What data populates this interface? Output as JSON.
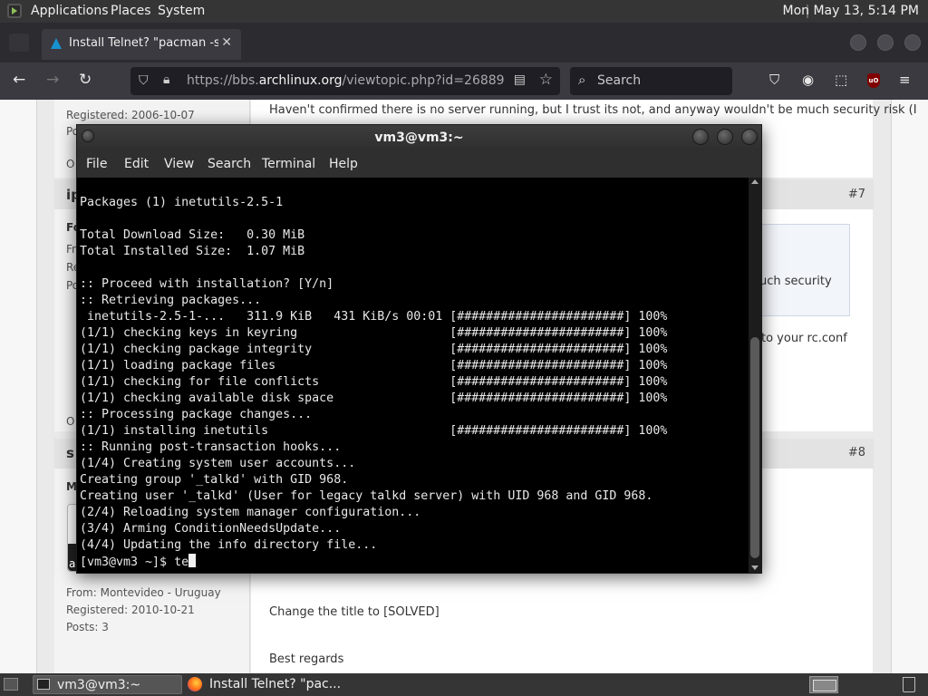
{
  "top_panel": {
    "menus": [
      "Applications",
      "Places",
      "System"
    ],
    "clock": "Mon May 13,  5:14 PM"
  },
  "browser": {
    "tab_title": "Install Telnet? \"pacman -s te",
    "tab_close": "✕",
    "url_prefix": "https://bbs.",
    "url_domain": "archlinux.org",
    "url_suffix": "/viewtopic.php?id=26889",
    "search_placeholder": "Search"
  },
  "page": {
    "post_top_text": "Haven't confirmed there is no server running, but I trust its not, and anyway wouldn't be much security risk (I",
    "registered_1": "Registered: 2006-10-07",
    "post_label_po": "Po",
    "post_label_o": "O",
    "author_2_fragment": "ip",
    "post_num_7": "#7",
    "frag_fo": "Fo",
    "frag_fr": "Fr",
    "frag_re": "Re",
    "frag_po": "Po",
    "quote_tail": "uch security",
    "rc_conf_tail": "to your rc.conf",
    "frag_o2": "O",
    "author_3_fragment": "s",
    "post_num_8": "#8",
    "frag_m": "M",
    "frag_a": "a",
    "from": "From: Montevideo - Uruguay",
    "registered_2": "Registered: 2010-10-21",
    "posts": "Posts: 3",
    "change_title": "Change the title to [SOLVED]",
    "best_regards": "Best regards"
  },
  "terminal": {
    "title": "vm3@vm3:~",
    "menus": [
      "File",
      "Edit",
      "View",
      "Search",
      "Terminal",
      "Help"
    ],
    "lines": [
      "Packages (1) inetutils-2.5-1",
      "",
      "Total Download Size:   0.30 MiB",
      "Total Installed Size:  1.07 MiB",
      "",
      ":: Proceed with installation? [Y/n]",
      ":: Retrieving packages...",
      " inetutils-2.5-1-...   311.9 KiB   431 KiB/s 00:01 [#######################] 100%",
      "(1/1) checking keys in keyring                     [#######################] 100%",
      "(1/1) checking package integrity                   [#######################] 100%",
      "(1/1) loading package files                        [#######################] 100%",
      "(1/1) checking for file conflicts                  [#######################] 100%",
      "(1/1) checking available disk space                [#######################] 100%",
      ":: Processing package changes...",
      "(1/1) installing inetutils                         [#######################] 100%",
      ":: Running post-transaction hooks...",
      "(1/4) Creating system user accounts...",
      "Creating group '_talkd' with GID 968.",
      "Creating user '_talkd' (User for legacy talkd server) with UID 968 and GID 968.",
      "(2/4) Reloading system manager configuration...",
      "(3/4) Arming ConditionNeedsUpdate...",
      "(4/4) Updating the info directory file...",
      "[vm3@vm3 ~]$ te"
    ]
  },
  "bottom_panel": {
    "tasks": [
      "vm3@vm3:~",
      "Install Telnet? \"pac..."
    ]
  }
}
